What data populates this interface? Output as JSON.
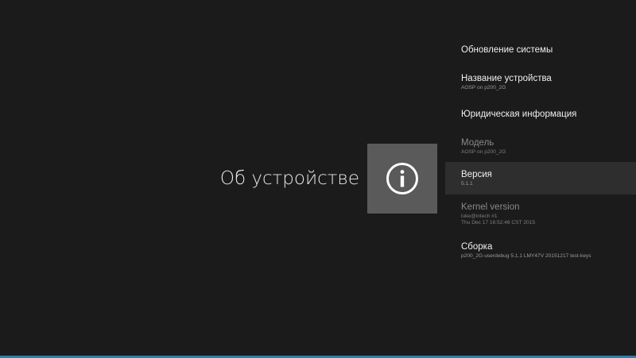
{
  "screen": {
    "title": "Об устройстве",
    "icon": "info-icon",
    "colors": {
      "background": "#1b1b1b",
      "tile": "#5a5a5a",
      "focused_row": "#2e2e2e",
      "accent_bar": "#2f7fa3"
    }
  },
  "menu": {
    "items": [
      {
        "title": "Обновление системы"
      },
      {
        "title": "Название устройства",
        "subtitle": "AOSP on p200_2G"
      },
      {
        "title": "Юридическая информация"
      },
      {
        "title": "Модель",
        "subtitle": "AOSP on p200_2G"
      },
      {
        "title": "Версия",
        "subtitle": "5.1.1"
      },
      {
        "title": "Kernel version",
        "subtitle_lines": [
          "luke@intech #1",
          "Thu Dec 17 16:52:46 CST 2015"
        ]
      },
      {
        "title": "Сборка",
        "subtitle": "p200_2G-userdebug 5.1.1 LMY47V 20151217 test-keys"
      }
    ]
  }
}
